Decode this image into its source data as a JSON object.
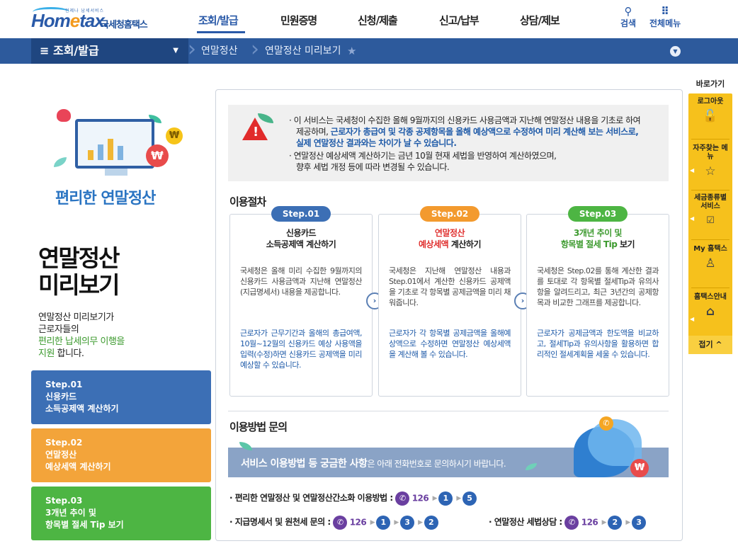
{
  "header": {
    "logo_small": "언제나 납세서비스",
    "logo_home": "Hom",
    "logo_e": "e",
    "logo_tax": "tax.",
    "logo_kr": "국세청홈택스",
    "gnb": [
      "조회/발급",
      "민원증명",
      "신청/제출",
      "신고/납부",
      "상담/제보"
    ],
    "search_label": "검색",
    "allmenu_label": "전체메뉴"
  },
  "nav": {
    "menu_label": "≡  조회/발급",
    "crumb1": "연말정산",
    "crumb2": "연말정산 미리보기"
  },
  "left": {
    "hero_caption": "편리한 연말정산",
    "title_line1": "연말정산",
    "title_line2": "미리보기",
    "desc_line1": "연말정산 미리보기가",
    "desc_line2": "근로자들의",
    "desc_green1": "편리한 납세의무 이행을",
    "desc_green2": "지원",
    "desc_end": " 합니다.",
    "steps": [
      {
        "l1": "Step.01",
        "l2": "신용카드",
        "l3": "소득공제액 계산하기",
        "color": "#3c6fb5"
      },
      {
        "l1": "Step.02",
        "l2": "연말정산",
        "l3": "예상세액 계산하기",
        "color": "#f3a43a"
      },
      {
        "l1": "Step.03",
        "l2": "3개년 추이 및",
        "l3": "항목별 절세 Tip 보기",
        "color": "#4db543"
      }
    ]
  },
  "notice": {
    "p1a": "· 이 서비스는 국세청이 수집한 올해 9월까지의 신용카드 사용금액과 지난해 연말정산 내용을 기초로 하여",
    "p1b": "제공하며, ",
    "p1b_blue": "근로자가 총급여 및 각종 공제항목을 올해 예상액으로 수정하여 미리 계산해 보는 서비스로,",
    "p1c_blue": "실제 연말정산 결과와는 차이가 날 수 있습니다.",
    "p2a": "· 연말정산 예상세액 계산하기는 금년 10월 현재 세법을 반영하여 계산하였으며,",
    "p2b": "향후 세법 개정 등에 따라 변경될 수 있습니다."
  },
  "procedure": {
    "title": "이용절차",
    "cards": [
      {
        "pill": "Step.01",
        "pill_color": "#3c6fb5",
        "t1": "신용카드",
        "t2": "소득공제액 계산하기",
        "t1_color": "#222",
        "desc": "국세청은 올해 미리 수집한 9월까지의 신용카드 사용금액과 지난해 연말정산(지급명세서) 내용을 제공합니다.",
        "blue": "근로자가 근무기간과 올해의 총급여액, 10월~12월의 신용카드 예상 사용액을 입력(수정)하면 신용카드 공제액을 미리 예상할 수 있습니다."
      },
      {
        "pill": "Step.02",
        "pill_color": "#f39a2e",
        "t1": "연말정산",
        "t2": "예상세액 계산하기",
        "t1_color": "#e0302f",
        "desc": "국세청은 지난해 연말정산 내용과 Step.01에서 계산한 신용카드 공제액을 기초로 각 항목별 공제금액을 미리 채워줍니다.",
        "blue": "근로자가 각 항목별 공제금액을 올해예상액으로 수정하면 연말정산 예상세액을 계산해 볼 수 있습니다."
      },
      {
        "pill": "Step.03",
        "pill_color": "#4db543",
        "t1": "3개년 추이 및",
        "t2": "항목별 절세 Tip 보기",
        "t1_color": "#3c9a2e",
        "desc": "국세청은 Step.02를 통해 계산한 결과를 토대로 각 항목별 절세Tip과 유의사항을 알려드리고, 최근 3년간의 공제항목과 비교한 그래프를 제공합니다.",
        "blue": "근로자가 공제금액과 한도액을 비교하고, 절세Tip과 유의사항을 활용하면 합리적인 절세계획을 세울 수 있습니다."
      }
    ]
  },
  "inquiry": {
    "title": "이용방법 문의",
    "banner_bold": "서비스 이용방법 등 궁금한 사항",
    "banner_rest": "은 아래 전화번호로 문의하시기 바랍니다.",
    "line1_label": "· 편리한 연말정산 및 연말정산간소화 이용방법 : ",
    "line2_label": "· 지급명세서 및 원천세 문의 : ",
    "line3_label": "· 연말정산 세법상담 : ",
    "tel": "126",
    "line1_digits": [
      "1",
      "5"
    ],
    "line2_digits": [
      "1",
      "3",
      "2"
    ],
    "line3_digits": [
      "2",
      "3"
    ]
  },
  "quick": {
    "title": "바로가기",
    "items": [
      "로그아웃",
      "자주찾는 메뉴",
      "세금종류별 서비스",
      "My 홈택스",
      "홈택스안내"
    ],
    "close": "접기 ^"
  }
}
